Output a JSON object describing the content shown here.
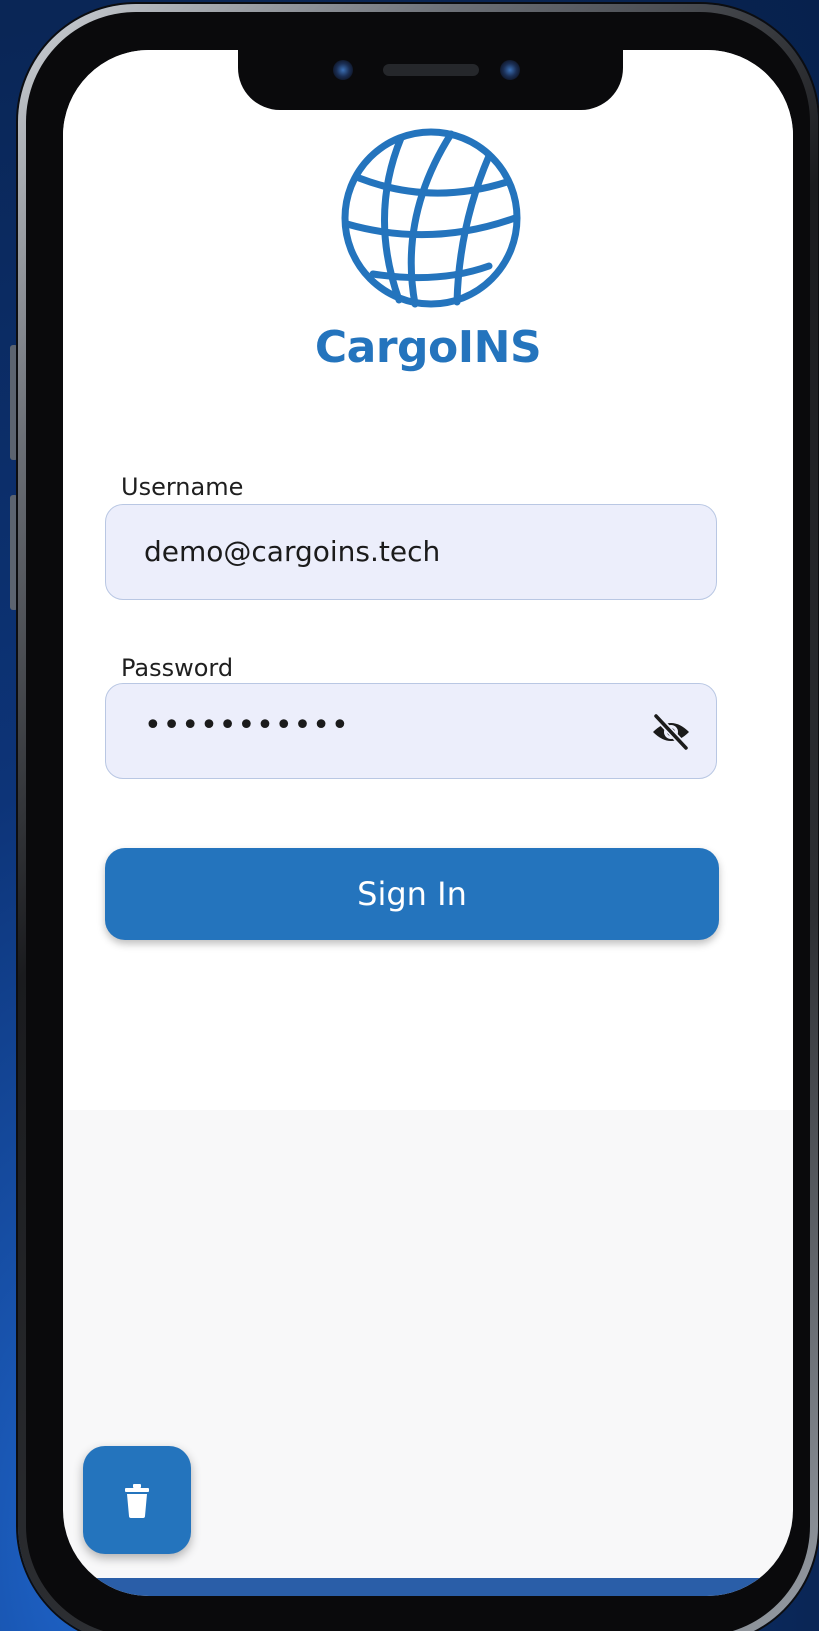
{
  "app": {
    "brand_name": "CargoINS",
    "accent_color": "#2474bd",
    "logo_icon": "globe-icon"
  },
  "login_form": {
    "username_label": "Username",
    "username_value": "demo@cargoins.tech",
    "password_label": "Password",
    "password_masked": "•••••••••••",
    "password_toggle_icon": "eye-off-icon",
    "submit_label": "Sign In"
  },
  "floating_action": {
    "icon": "trash-icon"
  }
}
